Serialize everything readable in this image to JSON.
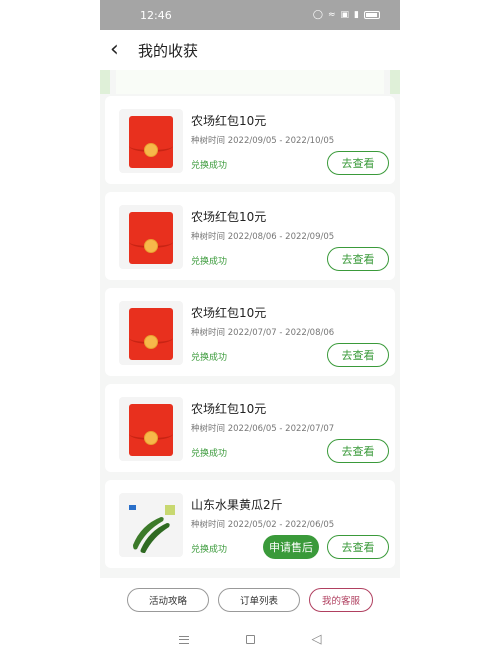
{
  "status_bar": {
    "time": "12:46",
    "icons": [
      "shield-icon",
      "wifi-icon",
      "hd-icon",
      "signal-icon",
      "battery-icon"
    ]
  },
  "header": {
    "back_icon": "chevron-left-icon",
    "title": "我的收获"
  },
  "rewards": [
    {
      "name": "农场红包10元",
      "date_label": "种树时间",
      "date_range": "2022/09/05 - 2022/10/05",
      "status": "兑换成功",
      "view_label": "去查看",
      "image": "red-envelope"
    },
    {
      "name": "农场红包10元",
      "date_label": "种树时间",
      "date_range": "2022/08/06 - 2022/09/05",
      "status": "兑换成功",
      "view_label": "去查看",
      "image": "red-envelope"
    },
    {
      "name": "农场红包10元",
      "date_label": "种树时间",
      "date_range": "2022/07/07 - 2022/08/06",
      "status": "兑换成功",
      "view_label": "去查看",
      "image": "red-envelope"
    },
    {
      "name": "农场红包10元",
      "date_label": "种树时间",
      "date_range": "2022/06/05 - 2022/07/07",
      "status": "兑换成功",
      "view_label": "去查看",
      "image": "red-envelope"
    },
    {
      "name": "山东水果黄瓜2斤",
      "date_label": "种树时间",
      "date_range": "2022/05/02 - 2022/06/05",
      "status": "兑换成功",
      "view_label": "去查看",
      "aftersale_label": "申请售后",
      "image": "cucumber"
    }
  ],
  "footer": {
    "buttons": [
      "活动攻略",
      "订单列表",
      "我的客服"
    ]
  },
  "colors": {
    "accent_green": "#3a9a3a",
    "envelope_red": "#e8301e",
    "service_pink": "#b04060",
    "status_bar_gray": "#a5a5a5"
  },
  "nav_bar": {
    "icons": [
      "menu-icon",
      "home-square-icon",
      "back-triangle-icon"
    ]
  }
}
